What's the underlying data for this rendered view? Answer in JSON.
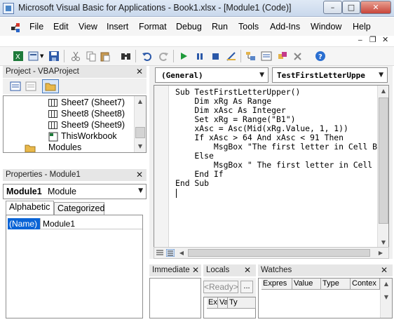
{
  "window": {
    "title": "Microsoft Visual Basic for Applications - Book1.xlsx - [Module1 (Code)]",
    "minimize": "–",
    "restore": "□",
    "close": "✕"
  },
  "menu": {
    "items": [
      "File",
      "Edit",
      "View",
      "Insert",
      "Format",
      "Debug",
      "Run",
      "Tools",
      "Add-Ins",
      "Window",
      "Help"
    ],
    "mdi_minimize": "_",
    "mdi_restore": "❐",
    "mdi_close": "✕"
  },
  "toolbar": {
    "icons": [
      "view-excel-icon",
      "insert-userform-icon",
      "save-icon",
      "cut-icon",
      "copy-icon",
      "paste-icon",
      "find-icon",
      "undo-icon",
      "redo-icon",
      "run-icon",
      "break-icon",
      "reset-icon",
      "design-mode-icon",
      "project-explorer-icon",
      "properties-window-icon",
      "object-browser-icon",
      "toolbox-icon",
      "help-icon"
    ]
  },
  "project": {
    "title": "Project - VBAProject",
    "close": "✕",
    "tree": [
      "Sheet7 (Sheet7)",
      "Sheet8 (Sheet8)",
      "Sheet9 (Sheet9)",
      "ThisWorkbook",
      "Modules"
    ]
  },
  "properties": {
    "title": "Properties - Module1",
    "close": "✕",
    "object_name": "Module1",
    "object_type": "Module",
    "tabs": [
      "Alphabetic",
      "Categorized"
    ],
    "row_name": "(Name)",
    "row_value": "Module1"
  },
  "code_window": {
    "object_combo": "(General)",
    "procedure_combo": "TestFirstLetterUppe",
    "lines": [
      "Sub TestFirstLetterUpper()",
      "    Dim xRg As Range",
      "    Dim xAsc As Integer",
      "    Set xRg = Range(\"B1\")",
      "    xAsc = Asc(Mid(xRg.Value, 1, 1))",
      "    If xAsc > 64 And xAsc < 91 Then",
      "        MsgBox \"The first letter in Cell B",
      "    Else",
      "        MsgBox \" The first letter in Cell",
      "    End If",
      "End Sub"
    ]
  },
  "immediate": {
    "title": "Immediate",
    "close": "✕"
  },
  "locals": {
    "title": "Locals",
    "close": "✕",
    "ready": "<Ready>",
    "ellipsis": "...",
    "columns": [
      "Ex",
      "Va",
      "Ty"
    ]
  },
  "watches": {
    "title": "Watches",
    "close": "✕",
    "columns": [
      "Expres",
      "Value",
      "Type",
      "Contex"
    ]
  },
  "colors": {
    "accent_selection": "#0a64d6",
    "title_gradient": "#c9d8ec",
    "pane_bg": "#e6e6e6"
  }
}
